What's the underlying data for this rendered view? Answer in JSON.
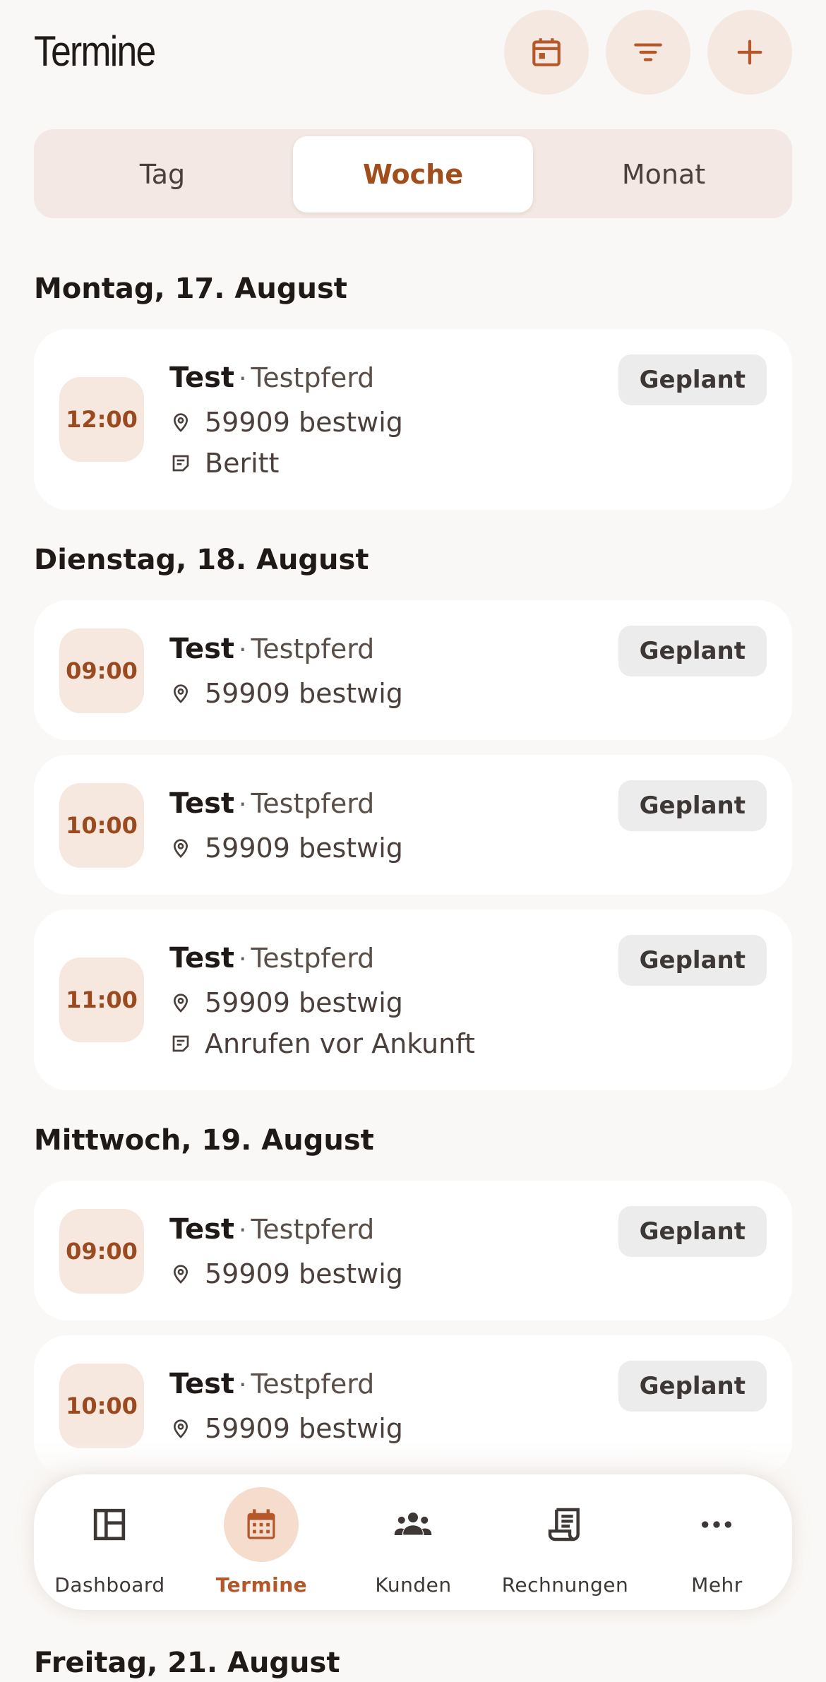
{
  "header": {
    "title": "Termine",
    "buttons": [
      {
        "icon": "calendar-icon"
      },
      {
        "icon": "filter-icon"
      },
      {
        "icon": "plus-icon"
      }
    ]
  },
  "view_switch": {
    "options": [
      "Tag",
      "Woche",
      "Monat"
    ],
    "selected": "Woche"
  },
  "days": [
    {
      "label": "Montag, 17. August",
      "appointments": [
        {
          "time": "12:00",
          "client": "Test",
          "separator": "·",
          "horse": "Testpferd",
          "location": "59909 bestwig",
          "note": "Beritt",
          "status": "Geplant"
        }
      ]
    },
    {
      "label": "Dienstag, 18. August",
      "appointments": [
        {
          "time": "09:00",
          "client": "Test",
          "separator": "·",
          "horse": "Testpferd",
          "location": "59909 bestwig",
          "status": "Geplant"
        },
        {
          "time": "10:00",
          "client": "Test",
          "separator": "·",
          "horse": "Testpferd",
          "location": "59909 bestwig",
          "status": "Geplant"
        },
        {
          "time": "11:00",
          "client": "Test",
          "separator": "·",
          "horse": "Testpferd",
          "location": "59909 bestwig",
          "note": "Anrufen vor Ankunft",
          "status": "Geplant"
        }
      ]
    },
    {
      "label": "Mittwoch, 19. August",
      "appointments": [
        {
          "time": "09:00",
          "client": "Test",
          "separator": "·",
          "horse": "Testpferd",
          "location": "59909 bestwig",
          "status": "Geplant"
        },
        {
          "time": "10:00",
          "client": "Test",
          "separator": "·",
          "horse": "Testpferd",
          "location": "59909 bestwig",
          "status": "Geplant"
        }
      ]
    },
    {
      "label": "Freitag, 21. August",
      "appointments": []
    }
  ],
  "bottom_nav": {
    "items": [
      {
        "label": "Dashboard",
        "icon": "dashboard-icon"
      },
      {
        "label": "Termine",
        "icon": "calendar-icon"
      },
      {
        "label": "Kunden",
        "icon": "people-icon"
      },
      {
        "label": "Rechnungen",
        "icon": "receipt-icon"
      },
      {
        "label": "Mehr",
        "icon": "more-icon"
      }
    ],
    "active": "Termine"
  },
  "colors": {
    "accent": "#b4582a",
    "accent_dark": "#9a4a1e",
    "accent_soft": "#f6e7df",
    "background": "#faf8f6",
    "status_bg": "#ececec"
  }
}
